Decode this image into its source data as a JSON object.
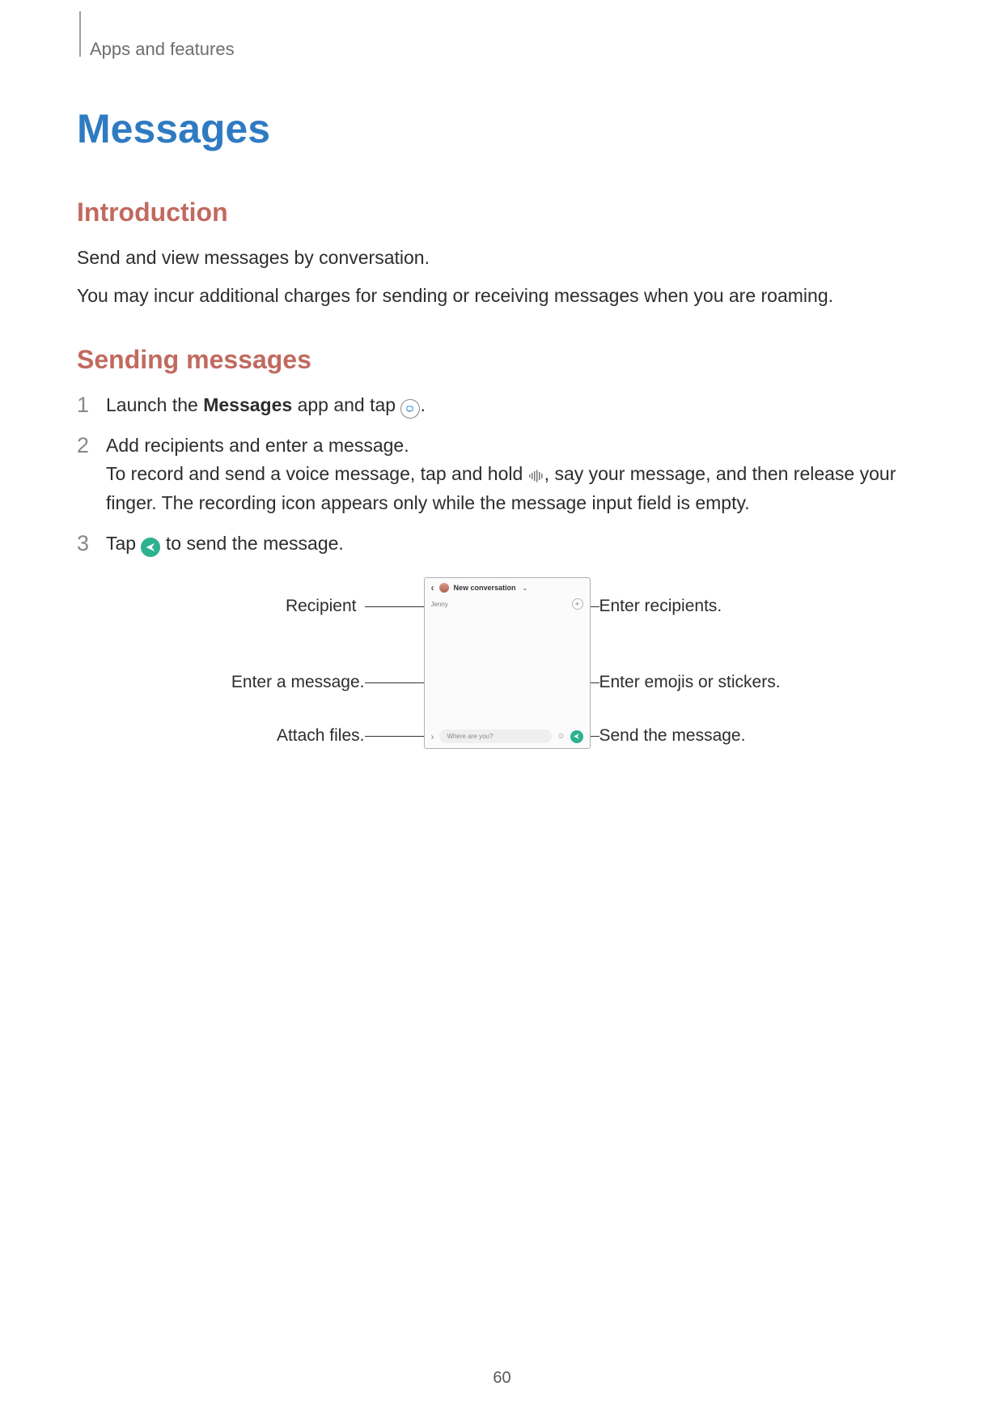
{
  "header": {
    "section": "Apps and features"
  },
  "title": "Messages",
  "intro": {
    "heading": "Introduction",
    "p1": "Send and view messages by conversation.",
    "p2": "You may incur additional charges for sending or receiving messages when you are roaming."
  },
  "sending": {
    "heading": "Sending messages",
    "step1": {
      "num": "1",
      "pre": "Launch the ",
      "bold": "Messages",
      "mid": " app and tap ",
      "post": "."
    },
    "step2": {
      "num": "2",
      "line1": "Add recipients and enter a message.",
      "line2a": "To record and send a voice message, tap and hold ",
      "line2b": ", say your message, and then release your finger. The recording icon appears only while the message input field is empty."
    },
    "step3": {
      "num": "3",
      "pre": "Tap ",
      "post": " to send the message."
    }
  },
  "illustration": {
    "phone": {
      "back_chevron": "‹",
      "title": "New conversation",
      "recipient_name": "Jenny",
      "message_placeholder": "Where are you?"
    },
    "callouts": {
      "recipient": "Recipient",
      "enter_message": "Enter a message.",
      "attach_files": "Attach files.",
      "enter_recipients": "Enter recipients.",
      "enter_emojis": "Enter emojis or stickers.",
      "send_message": "Send the message."
    }
  },
  "page_number": "60"
}
